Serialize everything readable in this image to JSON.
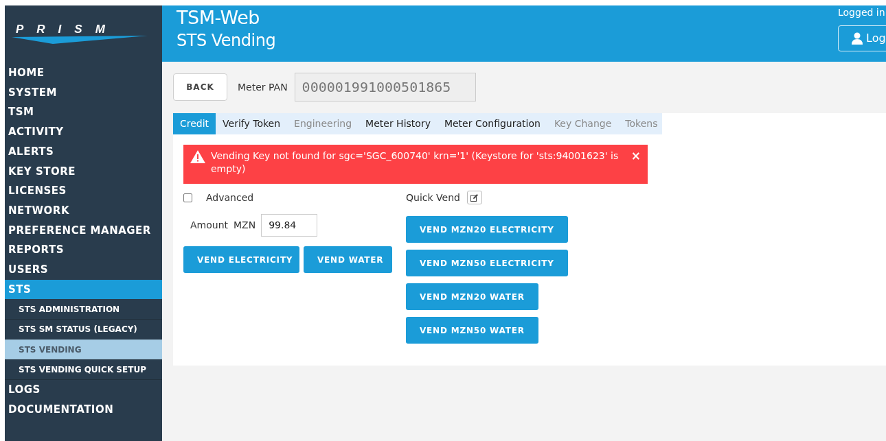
{
  "logo": {
    "text": "PRISM"
  },
  "header": {
    "app_title": "TSM-Web",
    "page_title": "STS Vending",
    "user_label": "Logged in",
    "logout_button": "Log"
  },
  "sidebar": {
    "items": [
      {
        "label": "HOME",
        "selected": false
      },
      {
        "label": "SYSTEM",
        "selected": false
      },
      {
        "label": "TSM",
        "selected": false
      },
      {
        "label": "ACTIVITY",
        "selected": false
      },
      {
        "label": "ALERTS",
        "selected": false
      },
      {
        "label": "KEY STORE",
        "selected": false
      },
      {
        "label": "LICENSES",
        "selected": false
      },
      {
        "label": "NETWORK",
        "selected": false
      },
      {
        "label": "PREFERENCE MANAGER",
        "selected": false
      },
      {
        "label": "REPORTS",
        "selected": false
      },
      {
        "label": "USERS",
        "selected": false
      },
      {
        "label": "STS",
        "selected": true,
        "children": [
          {
            "label": "STS ADMINISTRATION",
            "selected": false
          },
          {
            "label": "STS SM STATUS (LEGACY)",
            "selected": false
          },
          {
            "label": "STS VENDING",
            "selected": true
          },
          {
            "label": "STS VENDING QUICK SETUP",
            "selected": false
          }
        ]
      },
      {
        "label": "LOGS",
        "selected": false
      },
      {
        "label": "DOCUMENTATION",
        "selected": false
      }
    ]
  },
  "toolbar": {
    "back_button": "BACK",
    "meter_pan_label": "Meter PAN",
    "meter_pan_value": "000001991000501865"
  },
  "tabs": [
    {
      "label": "Credit",
      "selected": true,
      "disabled": false
    },
    {
      "label": "Verify Token",
      "selected": false,
      "disabled": false
    },
    {
      "label": "Engineering",
      "selected": false,
      "disabled": true
    },
    {
      "label": "Meter History",
      "selected": false,
      "disabled": false
    },
    {
      "label": "Meter Configuration",
      "selected": false,
      "disabled": false
    },
    {
      "label": "Key Change",
      "selected": false,
      "disabled": true
    },
    {
      "label": "Tokens",
      "selected": false,
      "disabled": true
    }
  ],
  "alert": {
    "message": "Vending Key not found for sgc='SGC_600740' krn='1' (Keystore for 'sts:94001623' is empty)",
    "close": "×"
  },
  "credit": {
    "advanced": {
      "label": "Advanced",
      "checked": false
    },
    "amount_label": "Amount",
    "currency": "MZN",
    "amount_value": "99.84",
    "buttons": [
      "VEND ELECTRICITY",
      "VEND WATER"
    ]
  },
  "quick_vend": {
    "label": "Quick Vend",
    "buttons": [
      "VEND MZN20 ELECTRICITY",
      "VEND MZN50 ELECTRICITY",
      "VEND MZN20 WATER",
      "VEND MZN50 WATER"
    ]
  }
}
